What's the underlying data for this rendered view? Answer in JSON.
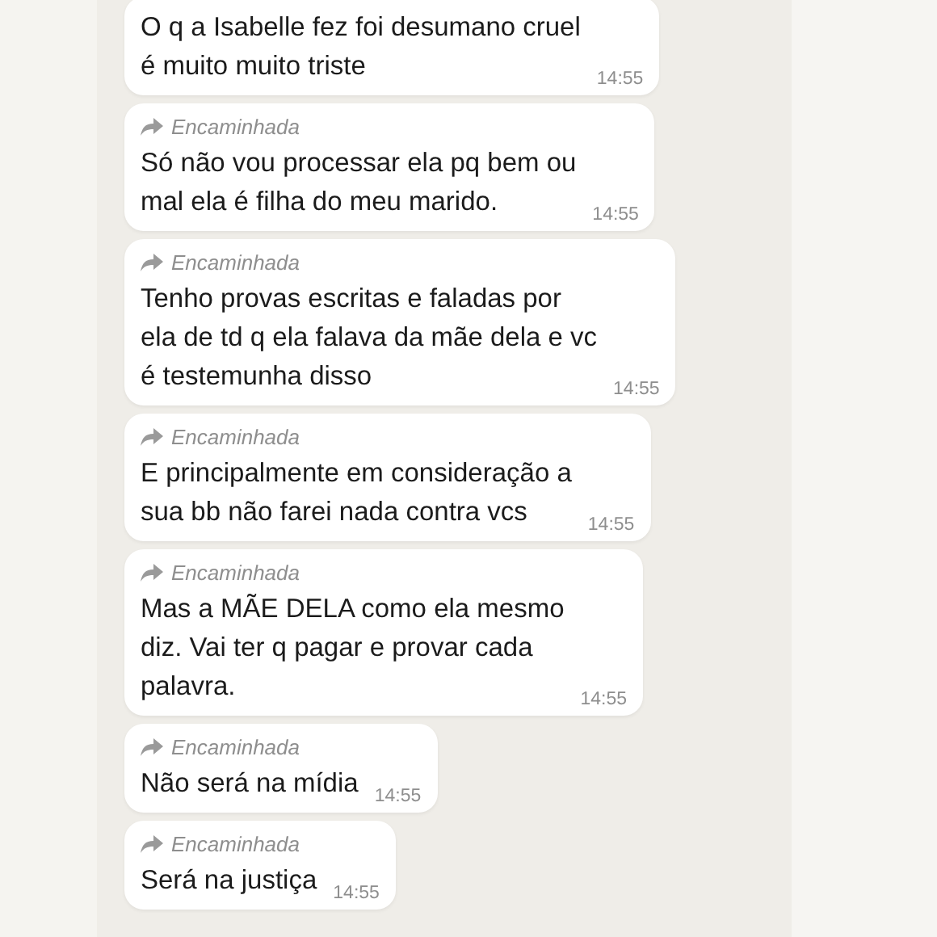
{
  "messages": [
    {
      "forwarded": false,
      "text": "O q a Isabelle fez foi desumano cruel\né muito muito triste",
      "time": "14:55"
    },
    {
      "forwarded": true,
      "forward_label": "Encaminhada",
      "text": "Só não vou processar ela pq bem ou\nmal ela é filha do meu marido.",
      "time": "14:55"
    },
    {
      "forwarded": true,
      "forward_label": "Encaminhada",
      "text": "Tenho provas escritas e faladas por\nela de td q ela falava da mãe dela e vc\né testemunha disso",
      "time": "14:55"
    },
    {
      "forwarded": true,
      "forward_label": "Encaminhada",
      "text": "E principalmente em consideração a\nsua bb não farei nada contra vcs",
      "time": "14:55"
    },
    {
      "forwarded": true,
      "forward_label": "Encaminhada",
      "text": "Mas a MÃE DELA como ela mesmo\ndiz. Vai ter q pagar e provar cada\npalavra.",
      "time": "14:55"
    },
    {
      "forwarded": true,
      "forward_label": "Encaminhada",
      "text": "Não será na mídia",
      "time": "14:55"
    },
    {
      "forwarded": true,
      "forward_label": "Encaminhada",
      "text": "Será na justiça",
      "time": "14:55"
    }
  ]
}
